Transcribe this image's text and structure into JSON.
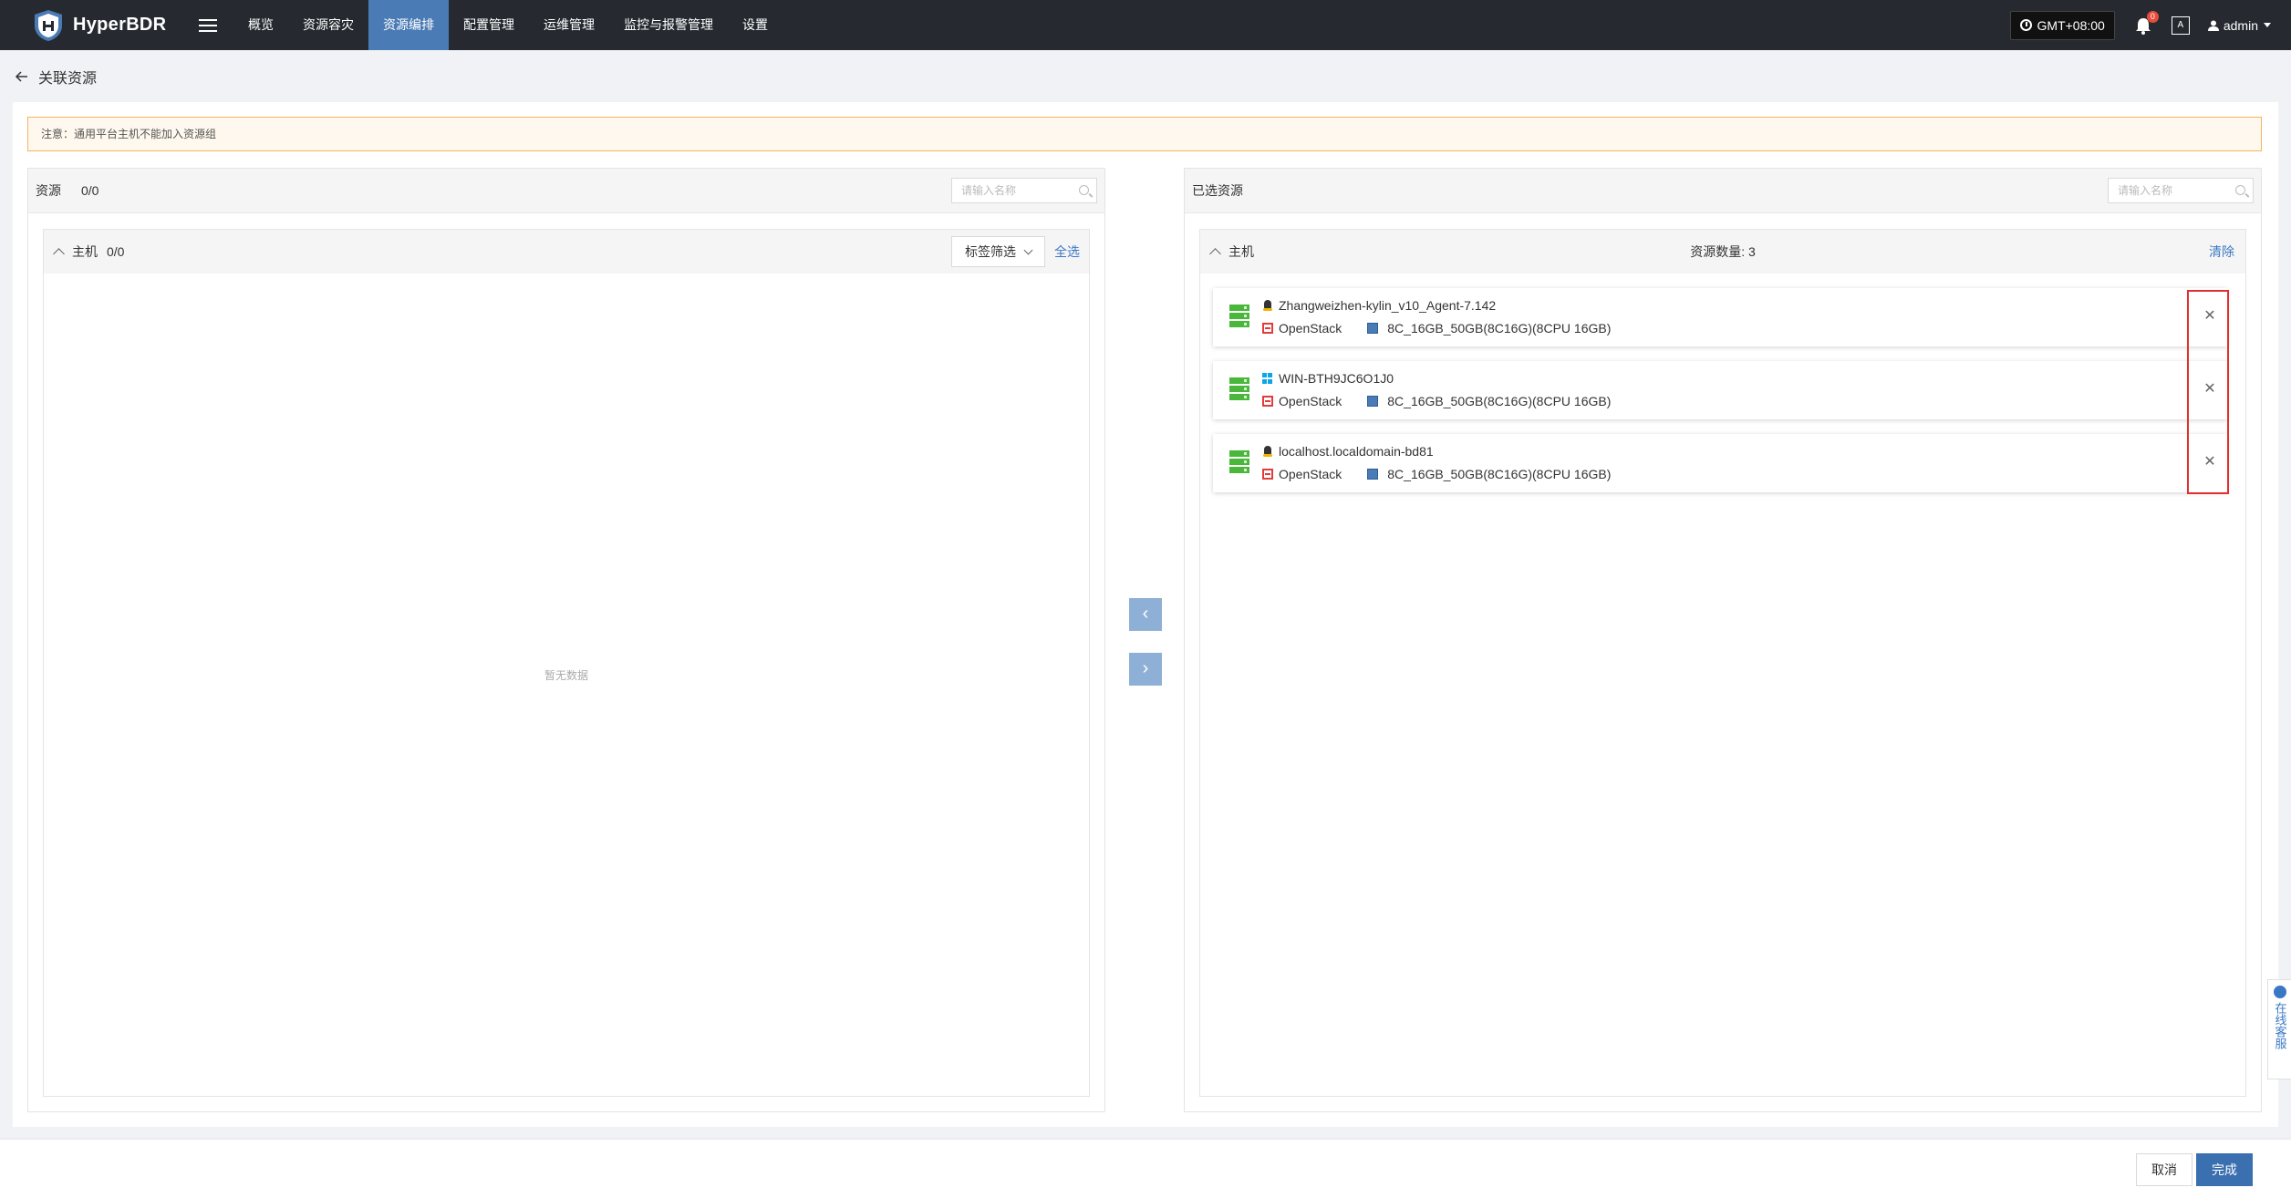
{
  "app": {
    "brand": "HyperBDR",
    "nav": [
      "概览",
      "资源容灾",
      "资源编排",
      "配置管理",
      "运维管理",
      "监控与报警管理",
      "设置"
    ],
    "active_nav_index": 2,
    "timezone": "GMT+08:00",
    "notification_count": "0",
    "lang_icon": "A",
    "user": "admin"
  },
  "page": {
    "title": "关联资源",
    "notice": "注意：通用平台主机不能加入资源组"
  },
  "left_panel": {
    "title": "资源",
    "count": "0/0",
    "search_placeholder": "请输入名称",
    "group_title": "主机",
    "group_count": "0/0",
    "tag_filter": "标签筛选",
    "select_all": "全选",
    "empty_text": "暂无数据"
  },
  "right_panel": {
    "title": "已选资源",
    "search_placeholder": "请输入名称",
    "group_title": "主机",
    "resource_count_label": "资源数量: 3",
    "clear": "清除",
    "items": [
      {
        "name": "Zhangweizhen-kylin_v10_Agent-7.142",
        "os": "linux",
        "platform": "OpenStack",
        "spec": "8C_16GB_50GB(8C16G)(8CPU 16GB)"
      },
      {
        "name": "WIN-BTH9JC6O1J0",
        "os": "windows",
        "platform": "OpenStack",
        "spec": "8C_16GB_50GB(8C16G)(8CPU 16GB)"
      },
      {
        "name": "localhost.localdomain-bd81",
        "os": "linux",
        "platform": "OpenStack",
        "spec": "8C_16GB_50GB(8C16G)(8CPU 16GB)"
      }
    ]
  },
  "transfer": {
    "left_arrow": "‹",
    "right_arrow": "›"
  },
  "footer": {
    "cancel": "取消",
    "confirm": "完成"
  },
  "side_service": "在线客服",
  "colors": {
    "nav_bg": "#262a30",
    "nav_active": "#4a7bb5",
    "primary": "#3a6fb0",
    "notice_border": "#f5b461",
    "highlight": "#e03030"
  }
}
